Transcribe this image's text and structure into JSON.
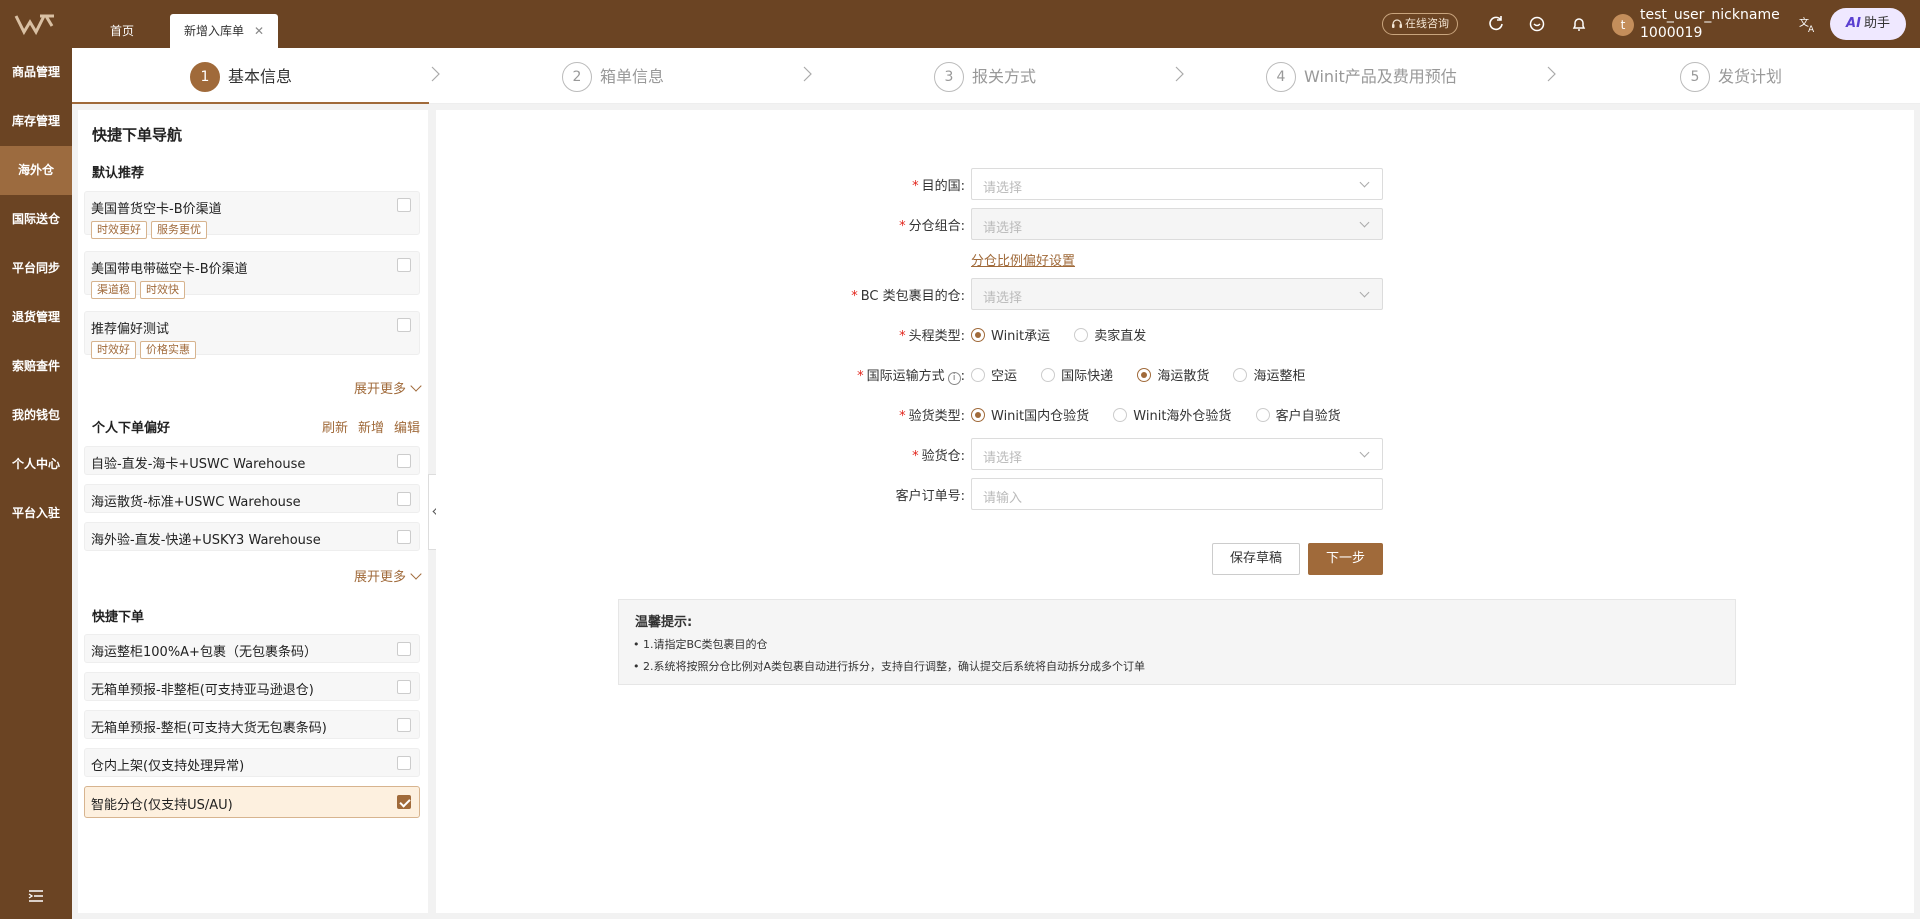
{
  "header": {
    "tabs": [
      {
        "label": "首页"
      },
      {
        "label": "新增入库单"
      }
    ],
    "consult_label": "在线咨询",
    "user_name": "test_user_nickname",
    "user_id": "1000019",
    "avatar_letter": "t",
    "ai_prefix": "AI",
    "ai_label": "助手"
  },
  "nav": {
    "items": [
      "商品管理",
      "库存管理",
      "海外仓",
      "国际送仓",
      "平台同步",
      "退货管理",
      "索赔查件",
      "我的钱包",
      "个人中心",
      "平台入驻"
    ],
    "active_index": 2
  },
  "steps": [
    {
      "num": "1",
      "label": "基本信息"
    },
    {
      "num": "2",
      "label": "箱单信息"
    },
    {
      "num": "3",
      "label": "报关方式"
    },
    {
      "num": "4",
      "label": "Winit产品及费用预估"
    },
    {
      "num": "5",
      "label": "发货计划"
    }
  ],
  "sidebar": {
    "title": "快捷下单导航",
    "default_title": "默认推荐",
    "default_items": [
      {
        "title": "美国普货空卡-B价渠道",
        "tags": [
          "时效更好",
          "服务更优"
        ]
      },
      {
        "title": "美国带电带磁空卡-B价渠道",
        "tags": [
          "渠道稳",
          "时效快"
        ]
      },
      {
        "title": "推荐偏好测试",
        "tags": [
          "时效好",
          "价格实惠"
        ]
      }
    ],
    "expand_more": "展开更多",
    "pref_title": "个人下单偏好",
    "pref_actions": [
      "刷新",
      "新增",
      "编辑"
    ],
    "pref_items": [
      "自验-直发-海卡+USWC Warehouse",
      "海运散货-标准+USWC Warehouse",
      "海外验-直发-快递+USKY3 Warehouse"
    ],
    "quick_title": "快捷下单",
    "quick_items": [
      "海运整柜100%A+包裹（无包裹条码）",
      "无箱单预报-非整柜(可支持亚马逊退仓)",
      "无箱单预报-整柜(可支持大货无包裹条码)",
      "仓内上架(仅支持处理异常)",
      "智能分仓(仅支持US/AU)"
    ],
    "quick_selected_index": 4
  },
  "form": {
    "dest_country": {
      "label": "目的国:",
      "placeholder": "请选择"
    },
    "split_group": {
      "label": "分仓组合:",
      "placeholder": "请选择"
    },
    "split_link": "分仓比例偏好设置",
    "bc_warehouse": {
      "label": "BC 类包裹目的仓:",
      "placeholder": "请选择"
    },
    "first_leg": {
      "label": "头程类型:",
      "options": [
        "Winit承运",
        "卖家直发"
      ],
      "selected": 0
    },
    "transport": {
      "label": "国际运输方式",
      "info_icon": "i",
      "colon": ":",
      "options": [
        "空运",
        "国际快递",
        "海运散货",
        "海运整柜"
      ],
      "selected": 2
    },
    "inspection": {
      "label": "验货类型:",
      "options": [
        "Winit国内仓验货",
        "Winit海外仓验货",
        "客户自验货"
      ],
      "selected": 0
    },
    "inspect_warehouse": {
      "label": "验货仓:",
      "placeholder": "请选择"
    },
    "customer_order": {
      "label": "客户订单号:",
      "placeholder": "请输入"
    },
    "save_draft": "保存草稿",
    "next": "下一步"
  },
  "tips": {
    "title": "温馨提示:",
    "lines": [
      "• 1.请指定BC类包裹目的仓",
      "• 2.系统将按照分仓比例对A类包裹自动进行拆分，支持自行调整，确认提交后系统将自动拆分成多个订单"
    ]
  },
  "colors": {
    "brand": "#6b4423",
    "accent": "#a06a3a",
    "required": "#e2231a"
  }
}
